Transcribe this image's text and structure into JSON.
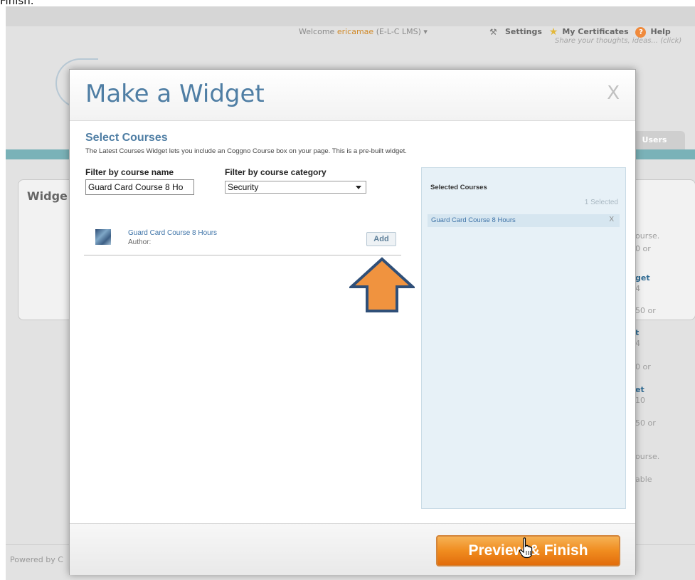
{
  "caption": "Finish.",
  "background": {
    "welcome_prefix": "Welcome",
    "username": "ericamae",
    "org": "(E-L-C LMS)",
    "nav": {
      "settings": "Settings",
      "certificates": "My Certificates",
      "help": "Help",
      "feedback": "Share your thoughts, ideas... (click)"
    },
    "users_tab": "Users",
    "widget_heading": "Widge",
    "right_fragments": [
      "ourse.",
      "0 or",
      "get",
      "4",
      "50 or",
      "t",
      "4",
      "0 or",
      "et",
      "10",
      "50 or",
      "ourse.",
      "able"
    ],
    "powered_by": "Powered by C"
  },
  "modal": {
    "title": "Make a Widget",
    "close": "X",
    "section_title": "Select Courses",
    "section_desc": "The Latest Courses Widget lets you include an Coggno Course box on your page. This is a pre-built widget.",
    "filter_name_label": "Filter by course name",
    "filter_name_value": "Guard Card Course 8 Ho",
    "filter_category_label": "Filter by course category",
    "filter_category_value": "Security",
    "courses": [
      {
        "title": "Guard Card Course 8 Hours",
        "author": "Author:",
        "add_label": "Add"
      }
    ],
    "selected": {
      "title": "Selected Courses",
      "count": "1 Selected",
      "items": [
        {
          "name": "Guard Card Course 8 Hours",
          "remove": "X"
        }
      ]
    },
    "preview_button": "Preview & Finish"
  },
  "colors": {
    "title_blue": "#4f7ea4",
    "arrow_orange": "#f0933f",
    "arrow_outline": "#2f4f78",
    "button_orange": "#f08c1f"
  },
  "icons": [
    "tools-icon",
    "star-icon",
    "help-icon",
    "close-icon",
    "dropdown-caret-icon",
    "course-thumbnail",
    "up-arrow-annotation",
    "hand-cursor-icon"
  ]
}
